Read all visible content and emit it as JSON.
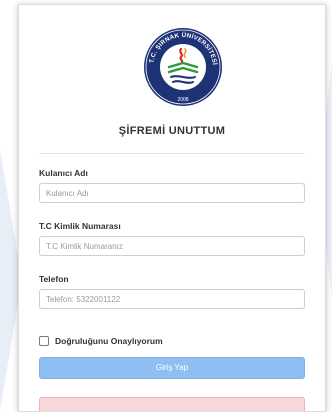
{
  "page": {
    "title": "ŞİFREMİ UNUTTUM"
  },
  "logo": {
    "ring_text": "T.C. ŞIRNAK ÜNİVERSİTESİ",
    "year": "2008"
  },
  "form": {
    "username": {
      "label": "Kulanıcı Adı",
      "placeholder": "Kulanıcı Adı",
      "value": ""
    },
    "tc": {
      "label": "T.C Kimlik Numarası",
      "placeholder": "T.C Kimlik Numaranız",
      "value": ""
    },
    "phone": {
      "label": "Telefon",
      "placeholder": "Telefon: 5322001122",
      "value": ""
    },
    "confirm": {
      "label": "Doğruluğunu Onaylıyorum",
      "checked": false
    },
    "submit_label": "Giriş Yap"
  },
  "colors": {
    "button": "#8fbff2",
    "logo_navy": "#1e3276",
    "logo_green": "#2e9a3a",
    "logo_red": "#d9262c",
    "alert": "#f8d7da"
  },
  "icons": [
    "university-logo",
    "checkbox"
  ]
}
